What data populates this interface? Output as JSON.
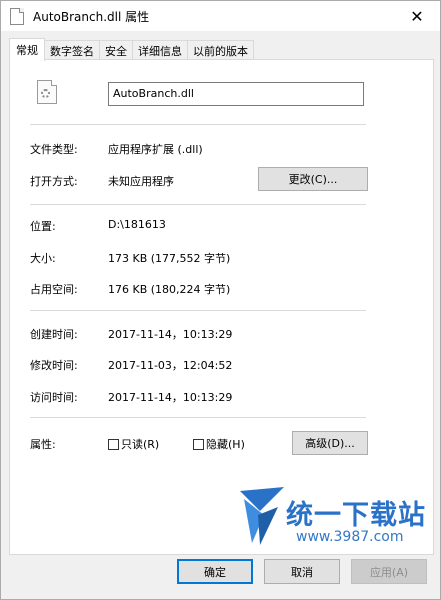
{
  "window": {
    "title": "AutoBranch.dll 属性",
    "close_glyph": "✕"
  },
  "tabs": [
    {
      "label": "常规",
      "active": true
    },
    {
      "label": "数字签名",
      "active": false
    },
    {
      "label": "安全",
      "active": false
    },
    {
      "label": "详细信息",
      "active": false
    },
    {
      "label": "以前的版本",
      "active": false
    }
  ],
  "general": {
    "file_name": "AutoBranch.dll",
    "file_type_label": "文件类型:",
    "file_type_value": "应用程序扩展 (.dll)",
    "opens_with_label": "打开方式:",
    "opens_with_value": "未知应用程序",
    "change_button": "更改(C)...",
    "location_label": "位置:",
    "location_value": "D:\\181613",
    "size_label": "大小:",
    "size_value": "173 KB (177,552 字节)",
    "size_on_disk_label": "占用空间:",
    "size_on_disk_value": "176 KB (180,224 字节)",
    "created_label": "创建时间:",
    "created_value": "2017-11-14，10:13:29",
    "modified_label": "修改时间:",
    "modified_value": "2017-11-03，12:04:52",
    "accessed_label": "访问时间:",
    "accessed_value": "2017-11-14，10:13:29",
    "attributes_label": "属性:",
    "readonly_label": "只读(R)",
    "readonly_checked": false,
    "hidden_label": "隐藏(H)",
    "hidden_checked": false,
    "advanced_button": "高级(D)..."
  },
  "watermark": {
    "text": "统一下载站",
    "url": "www.3987.com"
  },
  "footer": {
    "ok_button": "确定",
    "cancel_button": "取消",
    "apply_button": "应用(A)"
  }
}
